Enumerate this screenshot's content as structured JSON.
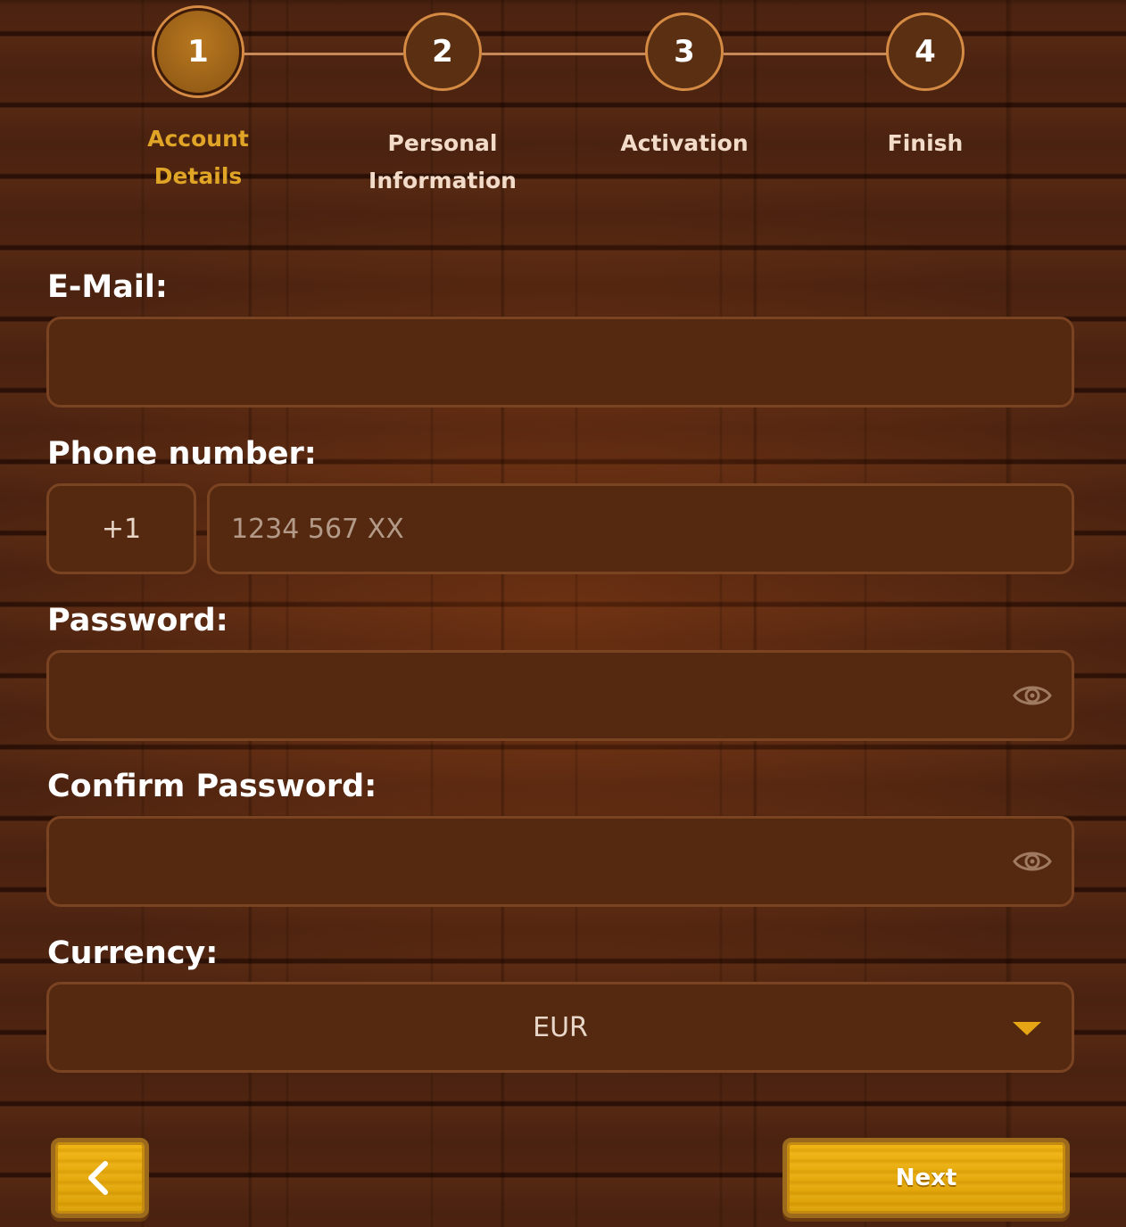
{
  "stepper": {
    "steps": [
      {
        "number": "1",
        "label_line1": "Account",
        "label_line2": "Details",
        "active": true
      },
      {
        "number": "2",
        "label_line1": "Personal",
        "label_line2": "Information",
        "active": false
      },
      {
        "number": "3",
        "label_line1": "Activation",
        "label_line2": "",
        "active": false
      },
      {
        "number": "4",
        "label_line1": "Finish",
        "label_line2": "",
        "active": false
      }
    ]
  },
  "form": {
    "email": {
      "label": "E-Mail:",
      "value": ""
    },
    "phone": {
      "label": "Phone number:",
      "prefix": "+1",
      "value": "",
      "placeholder": "1234 567 XX"
    },
    "password": {
      "label": "Password:",
      "value": "",
      "icon": "eye-icon"
    },
    "confirm_password": {
      "label": "Confirm Password:",
      "value": "",
      "icon": "eye-icon"
    },
    "currency": {
      "label": "Currency:",
      "selected": "EUR",
      "icon": "chevron-down-icon"
    }
  },
  "actions": {
    "back_icon": "chevron-left-icon",
    "next_label": "Next"
  },
  "colors": {
    "accent": "#e0a426",
    "input_bg": "#542910",
    "button_yellow": "#f0b412"
  }
}
